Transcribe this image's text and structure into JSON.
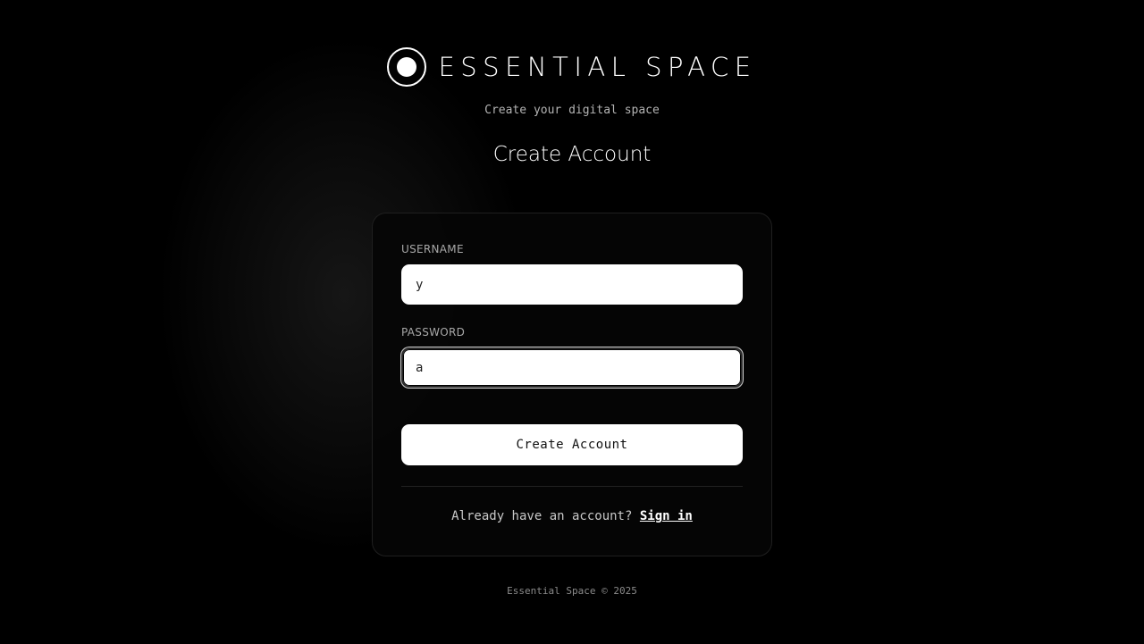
{
  "brand": {
    "name": "ESSENTIAL SPACE",
    "tagline": "Create your digital space",
    "logo_icon": "circle-dot-icon"
  },
  "page": {
    "title": "Create Account"
  },
  "form": {
    "username_label": "USERNAME",
    "username_value": "y",
    "password_label": "PASSWORD",
    "password_value": "a",
    "submit_label": "Create Account"
  },
  "signin": {
    "prompt": "Already have an account?",
    "link_label": "Sign in"
  },
  "footer": {
    "text": "Essential Space © 2025"
  },
  "colors": {
    "background": "#000000",
    "card_border": "#1f1f1f",
    "primary_button": "#ffffff",
    "text_muted": "#a8a8a8"
  }
}
